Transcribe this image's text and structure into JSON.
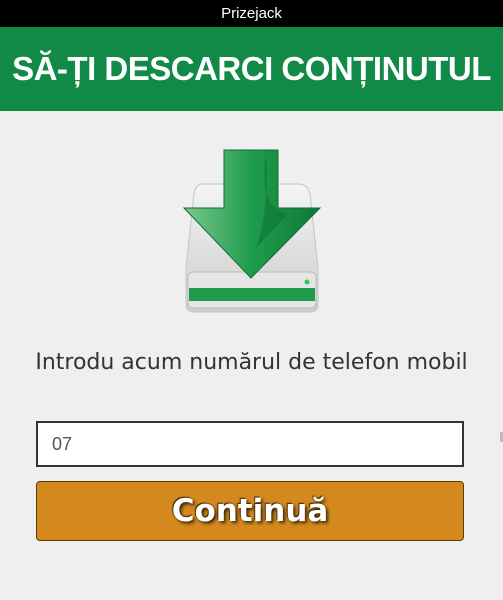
{
  "header": {
    "site_name": "Prizejack"
  },
  "banner": {
    "title": "SĂ-ȚI DESCARCI CONȚINUTUL"
  },
  "hero": {
    "icon": "download-drive-icon"
  },
  "form": {
    "prompt": "Introdu acum numărul de telefon mobil",
    "phone_value": "07",
    "continue_label": "Continuă"
  },
  "colors": {
    "banner": "#128a47",
    "button": "#d4891e",
    "accent_green": "#1a9a4a"
  }
}
